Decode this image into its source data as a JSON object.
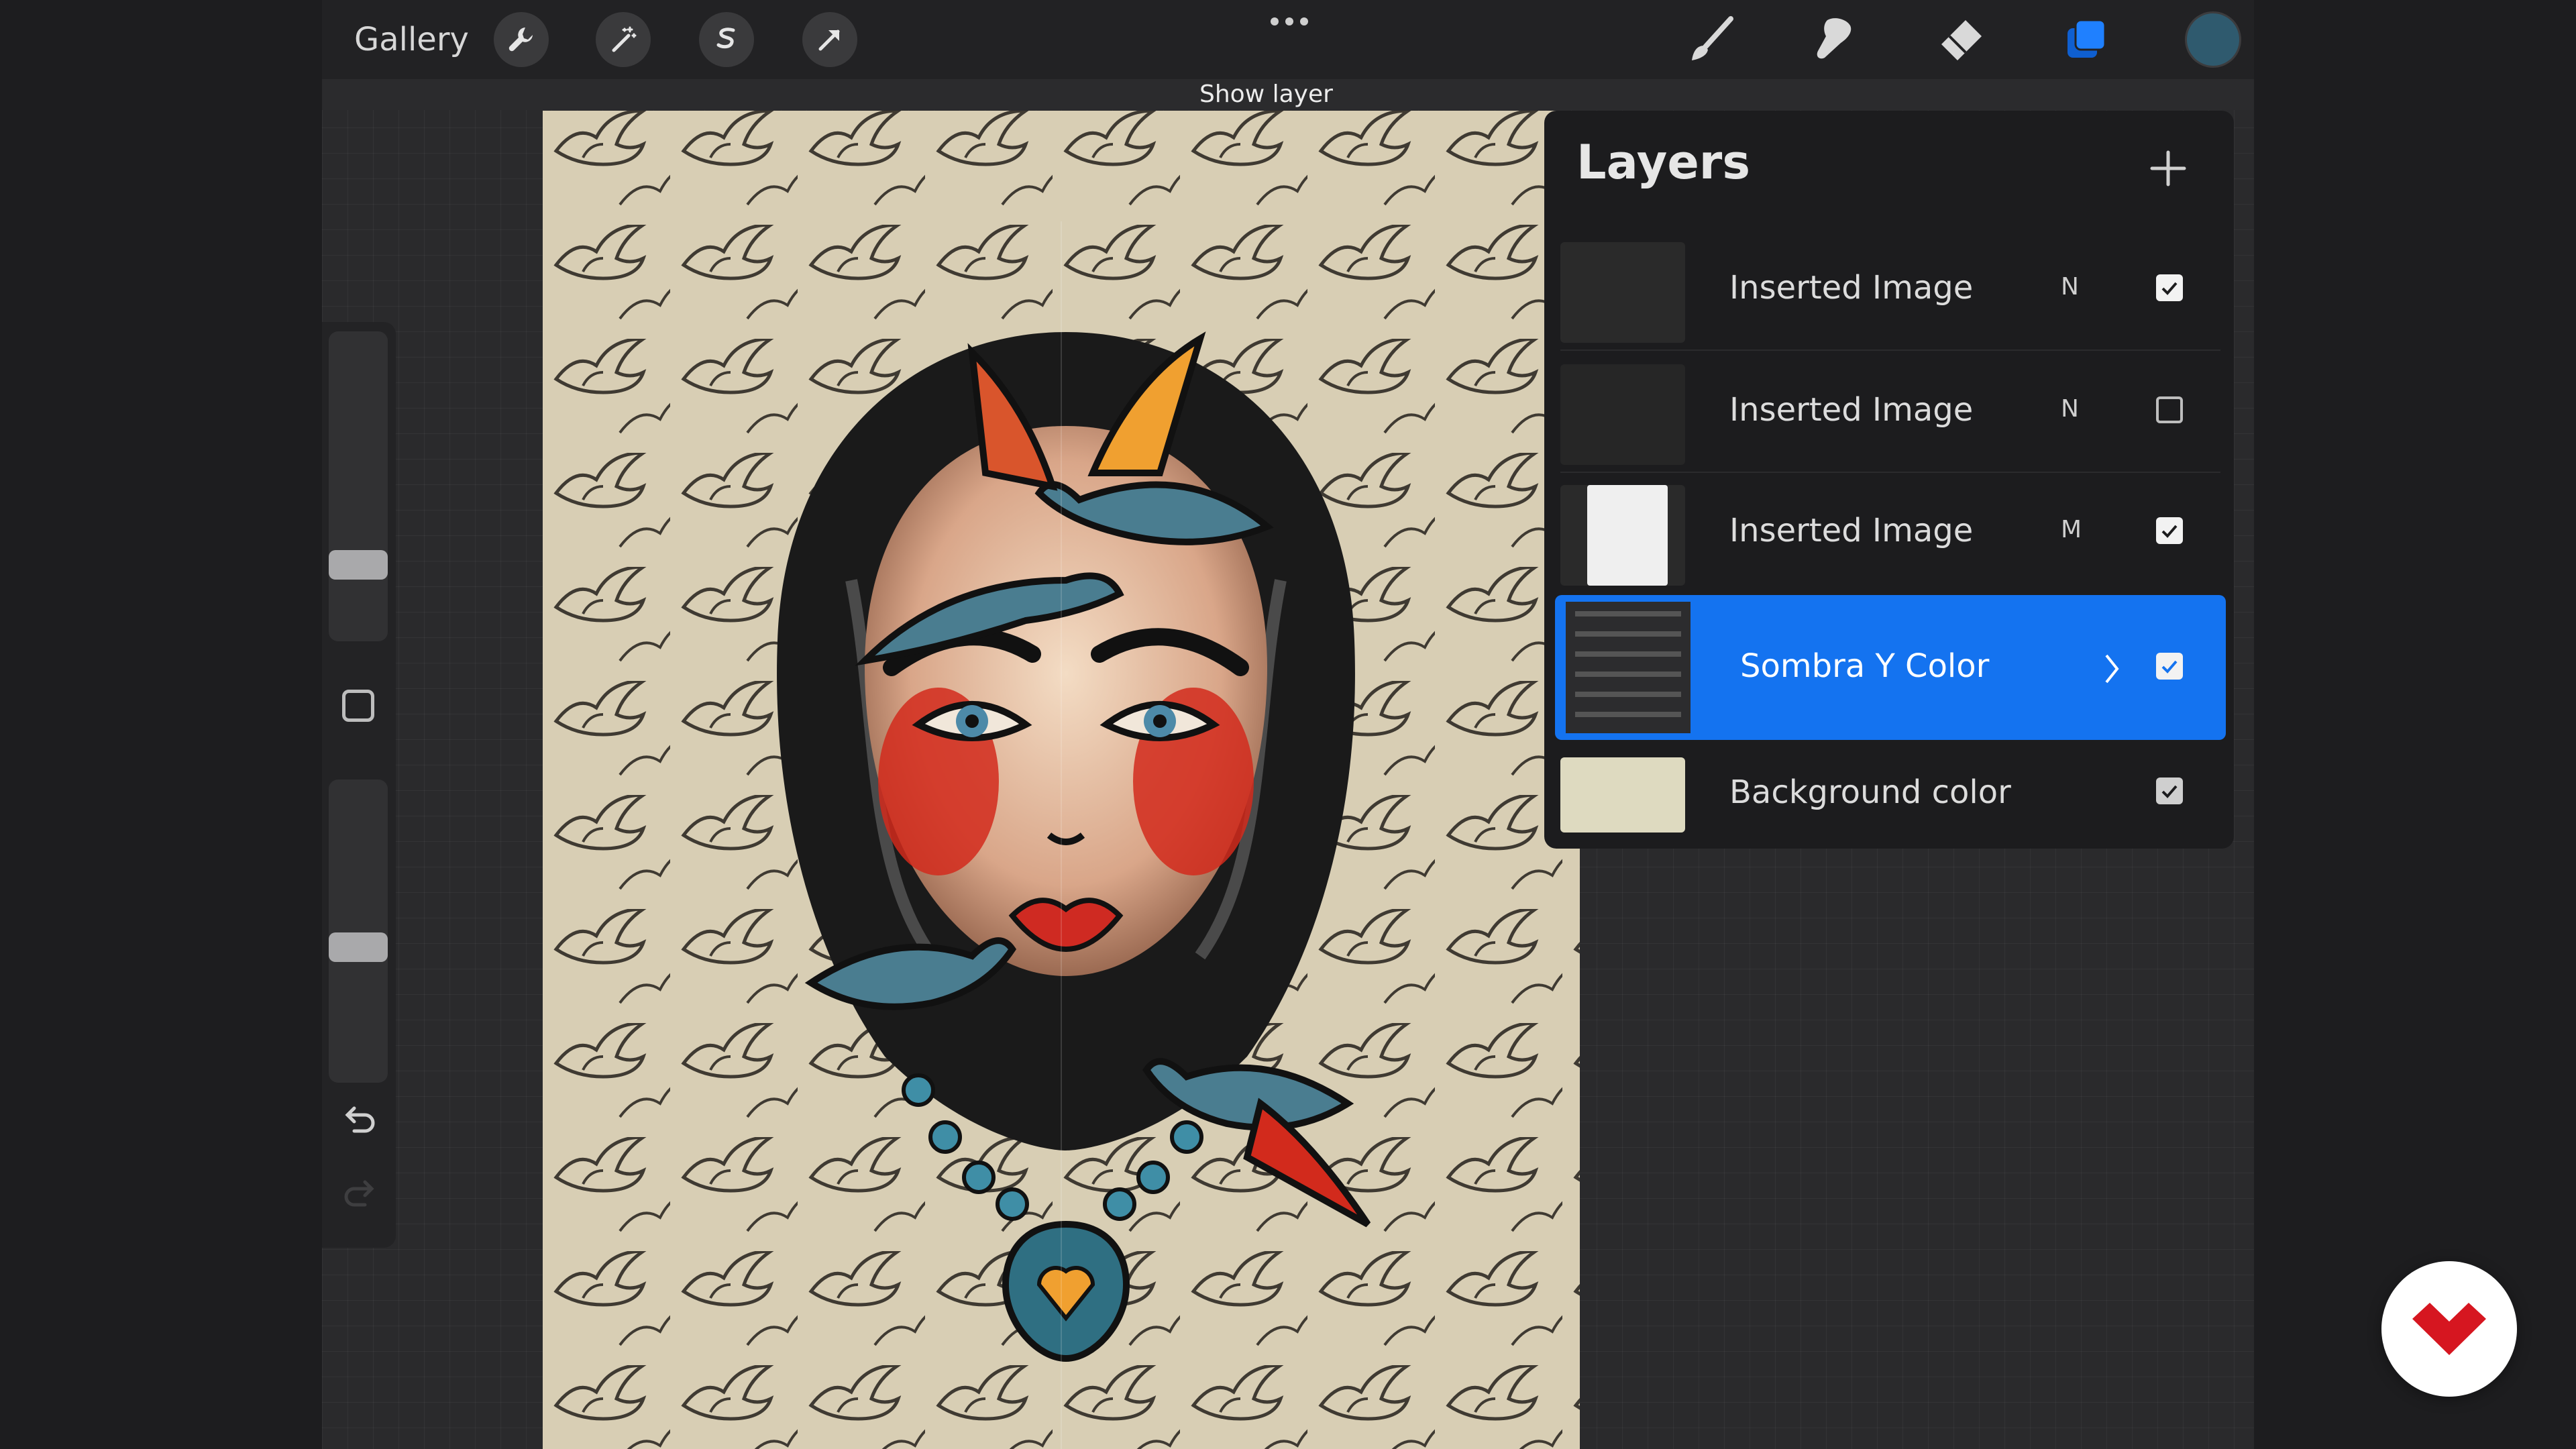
{
  "topbar": {
    "gallery_label": "Gallery",
    "left_tools": [
      "wrench-icon",
      "magic-wand-icon",
      "selection-icon",
      "transform-arrow-icon"
    ],
    "right_tools": [
      "brush-icon",
      "smudge-icon",
      "eraser-icon",
      "layers-icon"
    ],
    "active_tool": "layers-icon",
    "color_swatch": "#2f5a6e"
  },
  "tooltip": {
    "text": "Show layer"
  },
  "layers_panel": {
    "title": "Layers",
    "layers": [
      {
        "name": "Inserted Image",
        "blend": "N",
        "visible": true
      },
      {
        "name": "Inserted Image",
        "blend": "N",
        "visible": false
      },
      {
        "name": "Inserted Image",
        "blend": "M",
        "visible": true
      },
      {
        "name": "Sombra Y Color",
        "blend": "",
        "visible": true,
        "selected": true,
        "group": true
      },
      {
        "name": "Background color",
        "blend": "",
        "visible": true
      }
    ]
  },
  "colors": {
    "accent": "#1473f0",
    "canvas_bg": "#d8ceb4",
    "background_layer": "#dedac0"
  }
}
